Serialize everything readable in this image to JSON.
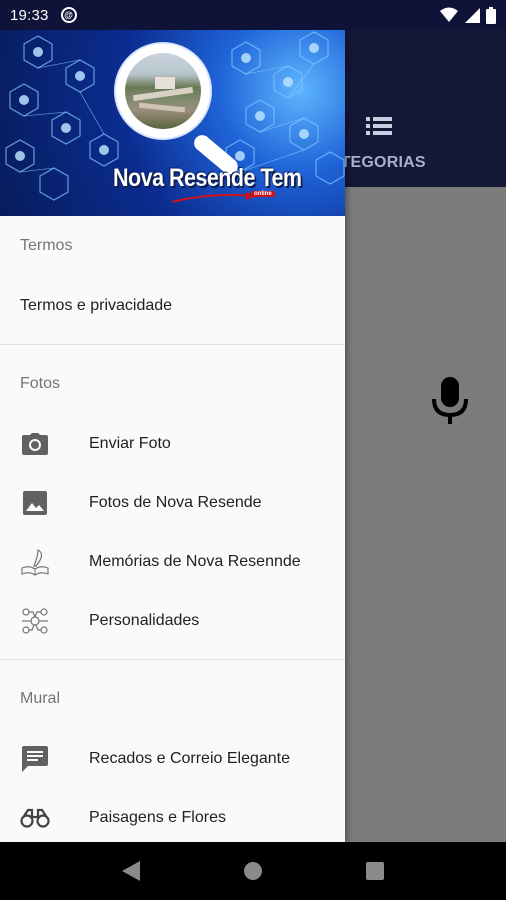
{
  "status_bar": {
    "time": "19:33",
    "icons": [
      "notification-badge-icon",
      "wifi-icon",
      "signal-icon",
      "battery-icon"
    ]
  },
  "app": {
    "tab_label": "ATEGORIAS",
    "toolbar_color": "#141736",
    "content_color": "#7b7b7b"
  },
  "drawer": {
    "header": {
      "logo_text": "Nova Resende Tem",
      "logo_badge": "online"
    },
    "sections": [
      {
        "title": "Termos",
        "items": [
          {
            "label": "Termos e privacidade",
            "icon": ""
          }
        ]
      },
      {
        "title": "Fotos",
        "items": [
          {
            "label": "Enviar Foto",
            "icon": "camera-icon"
          },
          {
            "label": "Fotos de Nova Resende",
            "icon": "image-icon"
          },
          {
            "label": "Memórias de Nova Resennde",
            "icon": "quill-book-icon"
          },
          {
            "label": "Personalidades",
            "icon": "circuit-head-icon"
          }
        ]
      },
      {
        "title": "Mural",
        "items": [
          {
            "label": "Recados e Correio Elegante",
            "icon": "message-icon"
          },
          {
            "label": "Paisagens e Flores",
            "icon": "binoculars-icon"
          }
        ]
      }
    ]
  },
  "nav_bar": {
    "buttons": [
      "back-icon",
      "home-icon",
      "recents-icon"
    ]
  }
}
